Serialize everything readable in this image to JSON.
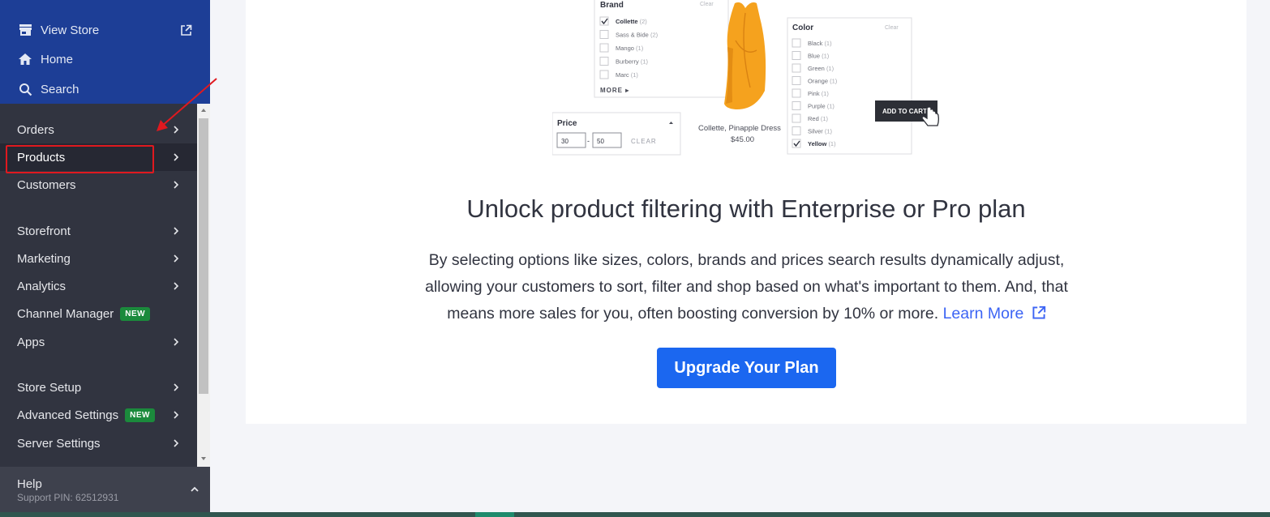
{
  "sidebar": {
    "top_items": [
      {
        "label": "View Store",
        "icon": "store-icon"
      },
      {
        "label": "Home",
        "icon": "home-icon"
      },
      {
        "label": "Search",
        "icon": "search-icon"
      }
    ],
    "nav_items": [
      {
        "label": "Orders"
      },
      {
        "label": "Products",
        "active": true
      },
      {
        "label": "Customers"
      },
      {
        "label": "Storefront"
      },
      {
        "label": "Marketing"
      },
      {
        "label": "Analytics"
      },
      {
        "label": "Channel Manager",
        "badge": "NEW"
      },
      {
        "label": "Apps"
      },
      {
        "label": "Store Setup"
      },
      {
        "label": "Advanced Settings",
        "badge": "NEW"
      },
      {
        "label": "Server Settings"
      }
    ],
    "help": {
      "title": "Help",
      "pin": "Support PIN: 62512931"
    }
  },
  "main": {
    "illustration": {
      "brand_title": "Brand",
      "brand_clear": "Clear",
      "brand_items": [
        {
          "label": "Collette",
          "count": "(2)",
          "checked": true
        },
        {
          "label": "Sass & Bide",
          "count": "(2)",
          "checked": false
        },
        {
          "label": "Mango",
          "count": "(1)",
          "checked": false
        },
        {
          "label": "Burberry",
          "count": "(1)",
          "checked": false
        },
        {
          "label": "Marc",
          "count": "(1)",
          "checked": false
        }
      ],
      "brand_more": "MORE ▸",
      "price_title": "Price",
      "price_min": "30",
      "price_max": "50",
      "price_clear": "CLEAR",
      "product_name": "Collette, Pinapple Dress",
      "product_price": "$45.00",
      "color_title": "Color",
      "color_clear": "Clear",
      "color_items": [
        {
          "label": "Black",
          "count": "(1)",
          "checked": false
        },
        {
          "label": "Blue",
          "count": "(1)",
          "checked": false
        },
        {
          "label": "Green",
          "count": "(1)",
          "checked": false
        },
        {
          "label": "Orange",
          "count": "(1)",
          "checked": false
        },
        {
          "label": "Pink",
          "count": "(1)",
          "checked": false
        },
        {
          "label": "Purple",
          "count": "(1)",
          "checked": false
        },
        {
          "label": "Red",
          "count": "(1)",
          "checked": false
        },
        {
          "label": "Silver",
          "count": "(1)",
          "checked": false
        },
        {
          "label": "Yellow",
          "count": "(1)",
          "checked": true
        }
      ],
      "add_to_cart": "ADD TO CART"
    },
    "headline": "Unlock product filtering with Enterprise or Pro plan",
    "description": "By selecting options like sizes, colors, brands and prices search results dynamically adjust, allowing your customers to sort, filter and shop based on what's important to them. And, that means more sales for you, often boosting conversion by 10% or more.",
    "learn_more": "Learn More",
    "upgrade_button": "Upgrade Your Plan"
  },
  "colors": {
    "sidebar_top": "#1d3e96",
    "sidebar_bg": "#313440",
    "accent_blue": "#1b67f0",
    "badge_green": "#1b8a3c",
    "annotation_red": "#e0191f"
  }
}
